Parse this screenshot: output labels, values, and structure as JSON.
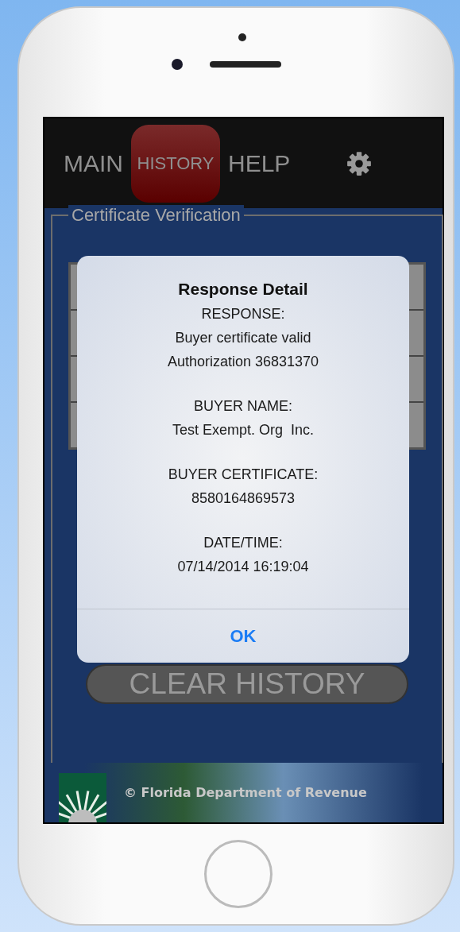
{
  "tabs": [
    {
      "label": "MAIN",
      "selected": false
    },
    {
      "label": "HISTORY",
      "selected": true
    },
    {
      "label": "HELP",
      "selected": false
    }
  ],
  "panel": {
    "title": "Certificate Verification"
  },
  "clear_button": "CLEAR HISTORY",
  "footer": {
    "copyright": "© Florida Department of Revenue"
  },
  "alert": {
    "title": "Response Detail",
    "sections": [
      {
        "label": "RESPONSE:",
        "values": [
          "Buyer certificate valid",
          "Authorization 36831370"
        ]
      },
      {
        "label": "BUYER NAME:",
        "values": [
          "Test Exempt. Org  Inc."
        ]
      },
      {
        "label": "BUYER CERTIFICATE:",
        "values": [
          "8580164869573"
        ]
      },
      {
        "label": "DATE/TIME:",
        "values": [
          "07/14/2014 16:19:04"
        ]
      }
    ],
    "button": "OK"
  }
}
